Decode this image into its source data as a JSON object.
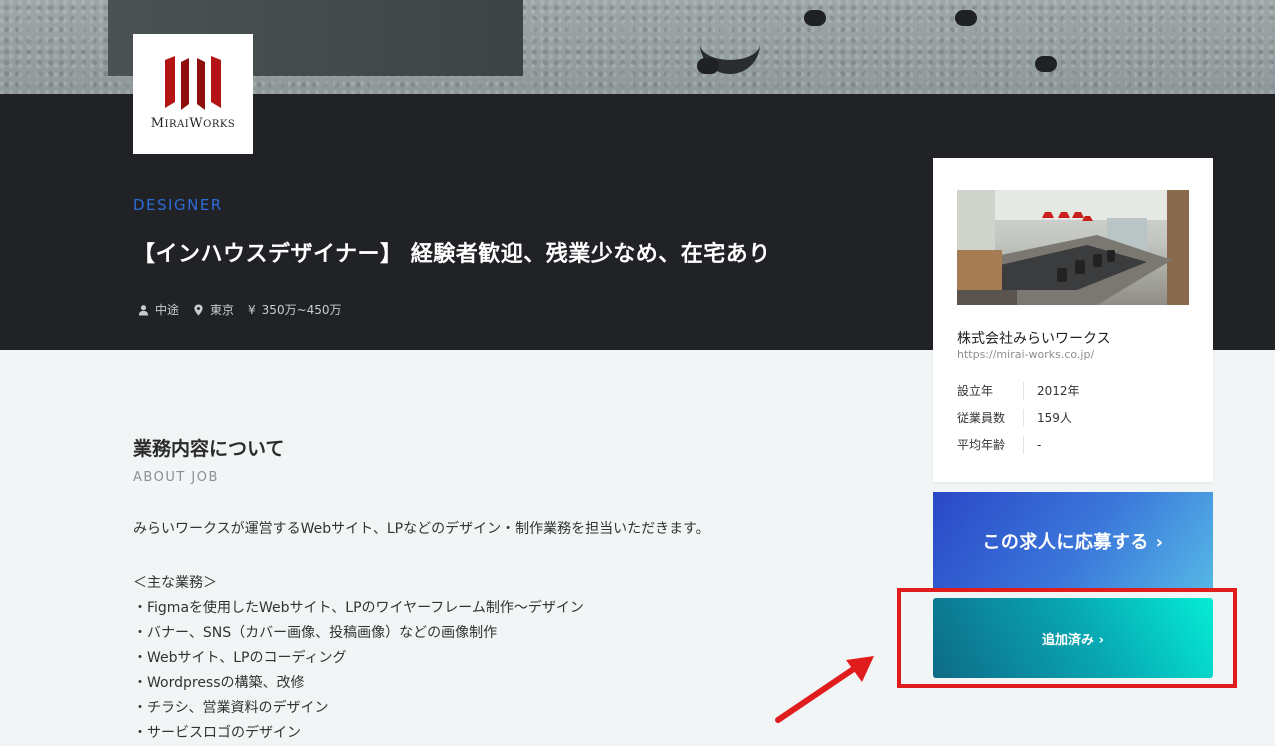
{
  "brand": {
    "logo_text": "MIRAIWORKS",
    "logo_color": "#b31414"
  },
  "job": {
    "category": "DESIGNER",
    "title": "【インハウスデザイナー】 経験者歓迎、残業少なめ、在宅あり",
    "meta": {
      "employment_type": "中途",
      "location": "東京",
      "salary_symbol": "¥",
      "salary": "350万~450万"
    }
  },
  "about": {
    "title": "業務内容について",
    "subtitle": "ABOUT JOB",
    "intro": "みらいワークスが運営するWebサイト、LPなどのデザイン・制作業務を担当いただきます。",
    "duties_heading": "＜主な業務＞",
    "duties": [
      "・Figmaを使用したWebサイト、LPのワイヤーフレーム制作～デザイン",
      "・バナー、SNS（カバー画像、投稿画像）などの画像制作",
      "・Webサイト、LPのコーディング",
      "・Wordpressの構築、改修",
      "・チラシ、営業資料のデザイン",
      "・サービスロゴのデザイン"
    ]
  },
  "company": {
    "name": "株式会社みらいワークス",
    "url": "https://mirai-works.co.jp/",
    "info": [
      {
        "key": "設立年",
        "value": "2012年"
      },
      {
        "key": "従業員数",
        "value": "159人"
      },
      {
        "key": "平均年齢",
        "value": "-"
      }
    ]
  },
  "actions": {
    "apply_label": "この求人に応募する ›",
    "added_label": "追加済み ›"
  },
  "colors": {
    "accent_blue": "#2d6bd8",
    "hero_dark": "#202226",
    "highlight_red": "#e11c1c"
  }
}
